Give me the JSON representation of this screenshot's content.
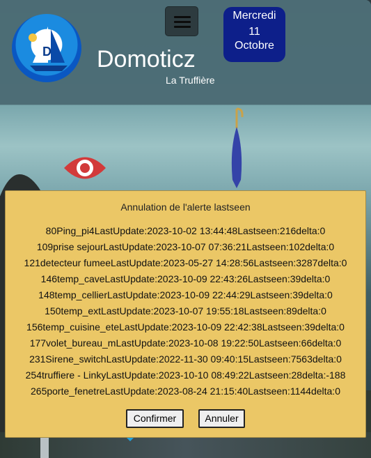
{
  "header": {
    "title": "Domoticz",
    "subtitle": "La Truffière",
    "date": {
      "day": "Mercredi",
      "number": "11",
      "month": "Octobre"
    }
  },
  "icons": {
    "logo": "sailboat-logo-icon",
    "menu": "hamburger-menu-icon",
    "eye": "eye-icon",
    "umbrella": "umbrella-icon"
  },
  "colors": {
    "dialog_bg": "#ebc766",
    "date_bg": "#0d1f8a",
    "header_bg": "#4c6c75"
  },
  "dialog": {
    "title": "Annulation de l'alerte lastseen",
    "entries": [
      "80Ping_pi4LastUpdate:2023-10-02 13:44:48Lastseen:216delta:0",
      "109prise sejourLastUpdate:2023-10-07 07:36:21Lastseen:102delta:0",
      "121detecteur fumeeLastUpdate:2023-05-27 14:28:56Lastseen:3287delta:0",
      "146temp_caveLastUpdate:2023-10-09 22:43:26Lastseen:39delta:0",
      "148temp_cellierLastUpdate:2023-10-09 22:44:29Lastseen:39delta:0",
      "150temp_extLastUpdate:2023-10-07 19:55:18Lastseen:89delta:0",
      "156temp_cuisine_eteLastUpdate:2023-10-09 22:42:38Lastseen:39delta:0",
      "177volet_bureau_mLastUpdate:2023-10-08 19:22:50Lastseen:66delta:0",
      "231Sirene_switchLastUpdate:2022-11-30 09:40:15Lastseen:7563delta:0",
      "254truffiere - LinkyLastUpdate:2023-10-10 08:49:22Lastseen:28delta:-188",
      "265porte_fenetreLastUpdate:2023-08-24 21:15:40Lastseen:1144delta:0"
    ],
    "confirm_label": "Confirmer",
    "cancel_label": "Annuler"
  }
}
